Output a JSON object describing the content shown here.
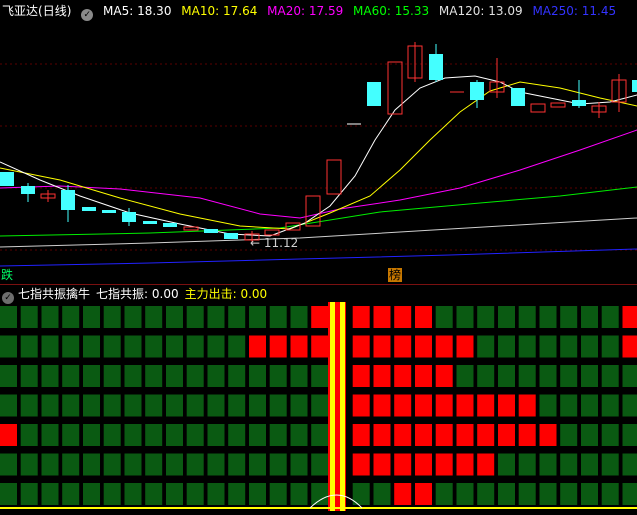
{
  "main_panel": {
    "stock_name": "飞亚达",
    "period": "(日线)",
    "ma": [
      {
        "label": "MA5: 18.30",
        "color": "#ffffff"
      },
      {
        "label": "MA10: 17.64",
        "color": "#ffff00"
      },
      {
        "label": "MA20: 17.59",
        "color": "#ff00ff"
      },
      {
        "label": "MA60: 15.33",
        "color": "#00ff00"
      },
      {
        "label": "MA120: 13.09",
        "color": "#e0e0e0"
      },
      {
        "label": "MA250: 11.45",
        "color": "#3333ff"
      }
    ],
    "low_price_label": "← 11.12",
    "marker_left": "跌",
    "marker_mid": "榜"
  },
  "sub_panel": {
    "title": "七指共振擒牛",
    "field1": "七指共振: 0.00",
    "field2": "主力出击: 0.00",
    "colors": {
      "on": "#ff0000",
      "off": "#0a5a12",
      "bar": "#ffff00"
    }
  },
  "chart_data": [
    {
      "type": "candlestick",
      "title": "飞亚达 (日线)",
      "series": [
        {
          "name": "MA5",
          "value": 18.3
        },
        {
          "name": "MA10",
          "value": 17.64
        },
        {
          "name": "MA20",
          "value": 17.59
        },
        {
          "name": "MA60",
          "value": 15.33
        },
        {
          "name": "MA120",
          "value": 13.09
        },
        {
          "name": "MA250",
          "value": 11.45
        }
      ],
      "annotations": [
        "11.12"
      ]
    },
    {
      "type": "heatmap",
      "title": "七指共振擒牛",
      "rows": 7,
      "columns": 31,
      "highlight_column": 16,
      "grid": [
        [
          0,
          0,
          0,
          0,
          0,
          0,
          0,
          0,
          0,
          0,
          0,
          0,
          0,
          0,
          0,
          1,
          0,
          1,
          1,
          1,
          1,
          0,
          0,
          0,
          0,
          0,
          0,
          0,
          0,
          0,
          1
        ],
        [
          0,
          0,
          0,
          0,
          0,
          0,
          0,
          0,
          0,
          0,
          0,
          0,
          1,
          1,
          1,
          1,
          0,
          1,
          1,
          1,
          1,
          1,
          1,
          0,
          0,
          0,
          0,
          0,
          0,
          0,
          1
        ],
        [
          0,
          0,
          0,
          0,
          0,
          0,
          0,
          0,
          0,
          0,
          0,
          0,
          0,
          0,
          0,
          0,
          0,
          1,
          1,
          1,
          1,
          1,
          0,
          0,
          0,
          0,
          0,
          0,
          0,
          0,
          0
        ],
        [
          0,
          0,
          0,
          0,
          0,
          0,
          0,
          0,
          0,
          0,
          0,
          0,
          0,
          0,
          0,
          0,
          0,
          1,
          1,
          1,
          1,
          1,
          1,
          1,
          1,
          1,
          0,
          0,
          0,
          0,
          0
        ],
        [
          1,
          0,
          0,
          0,
          0,
          0,
          0,
          0,
          0,
          0,
          0,
          0,
          0,
          0,
          0,
          0,
          0,
          1,
          1,
          1,
          1,
          1,
          1,
          1,
          1,
          1,
          1,
          0,
          0,
          0,
          0
        ],
        [
          0,
          0,
          0,
          0,
          0,
          0,
          0,
          0,
          0,
          0,
          0,
          0,
          0,
          0,
          0,
          0,
          0,
          1,
          1,
          1,
          1,
          1,
          1,
          1,
          0,
          0,
          0,
          0,
          0,
          0,
          0
        ],
        [
          0,
          0,
          0,
          0,
          0,
          0,
          0,
          0,
          0,
          0,
          0,
          0,
          0,
          0,
          0,
          0,
          0,
          0,
          0,
          1,
          1,
          0,
          0,
          0,
          0,
          0,
          0,
          0,
          0,
          0,
          0
        ]
      ]
    }
  ]
}
